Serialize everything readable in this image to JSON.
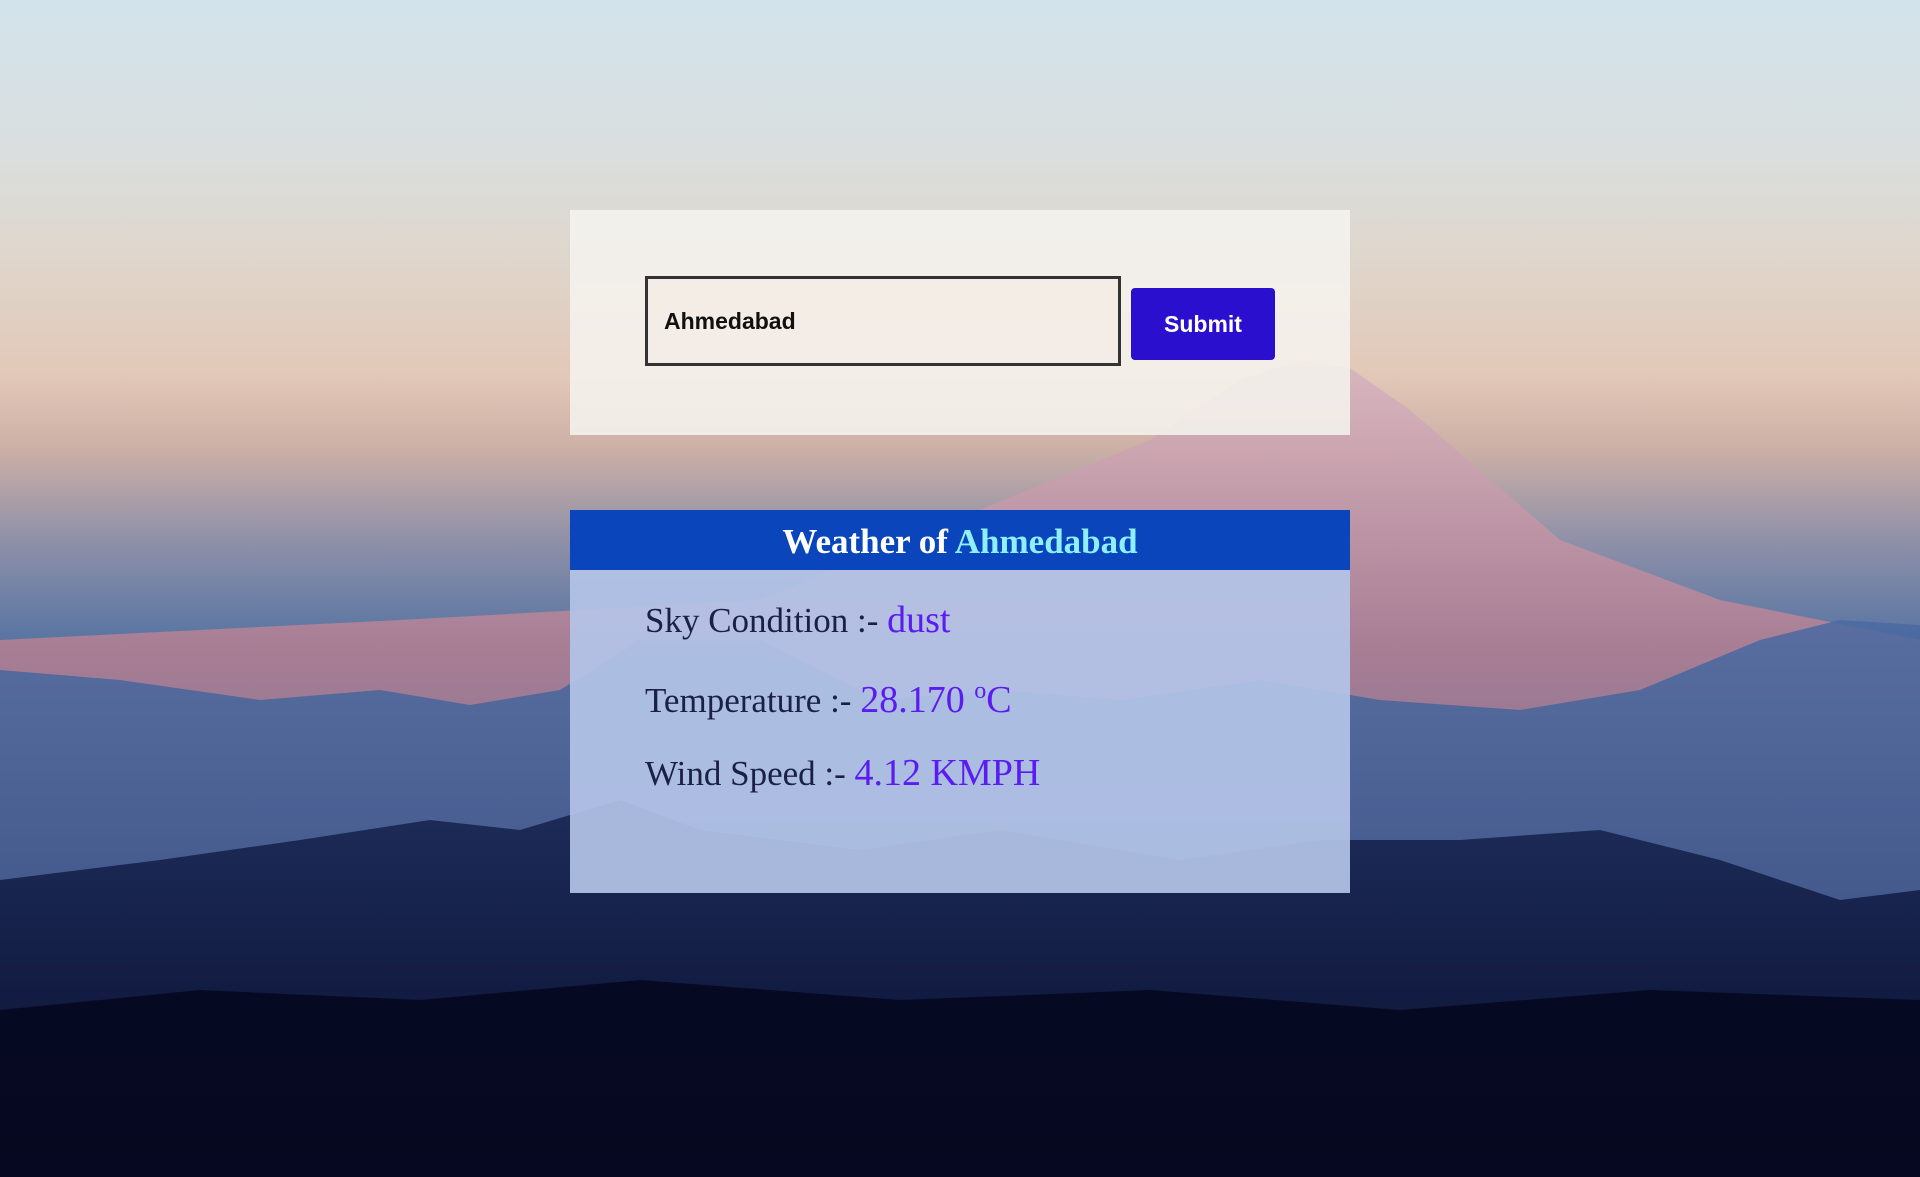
{
  "search": {
    "city_value": "Ahmedabad",
    "submit_label": "Submit"
  },
  "weather": {
    "header_prefix": "Weather of",
    "city": "Ahmedabad",
    "sky_label": "Sky Condition :-",
    "sky_value": "dust",
    "temp_label": "Temperature :-",
    "temp_value": "28.170",
    "temp_degree": "o",
    "temp_unit": "C",
    "wind_label": "Wind Speed :-",
    "wind_value": "4.12 KMPH"
  },
  "colors": {
    "submit_button": "#2a0fcf",
    "header_bg": "#0a45bb",
    "header_city": "#8ef0ff",
    "value_text": "#5a1cf0"
  }
}
